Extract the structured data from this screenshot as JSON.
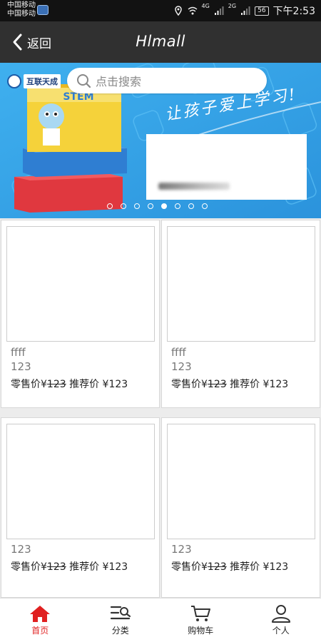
{
  "status_bar": {
    "carrier_line1": "中国移动",
    "carrier_line2": "中国移动",
    "network1": "4G",
    "network2": "2G",
    "battery": "56",
    "time": "下午2:53"
  },
  "header": {
    "back_label": "返回",
    "title": "Hlmall"
  },
  "banner": {
    "logo_text": "互联天成",
    "search_placeholder": "点击搜索",
    "slogan": "让孩子爱上学习!",
    "dot_count": 8,
    "active_dot": 4
  },
  "products": [
    {
      "name": "ffff",
      "num": "123",
      "retail_label": "零售价¥",
      "retail_price": "123",
      "recommend_label": "推荐价 ¥",
      "recommend_price": "123"
    },
    {
      "name": "ffff",
      "num": "123",
      "retail_label": "零售价¥",
      "retail_price": "123",
      "recommend_label": "推荐价 ¥",
      "recommend_price": "123"
    },
    {
      "name": "",
      "num": "123",
      "retail_label": "零售价¥",
      "retail_price": "123",
      "recommend_label": "推荐价 ¥",
      "recommend_price": "123"
    },
    {
      "name": "",
      "num": "123",
      "retail_label": "零售价¥",
      "retail_price": "123",
      "recommend_label": "推荐价 ¥",
      "recommend_price": "123"
    }
  ],
  "tabbar": {
    "items": [
      {
        "label": "首页",
        "icon": "home-icon",
        "active": true
      },
      {
        "label": "分类",
        "icon": "category-icon",
        "active": false
      },
      {
        "label": "购物车",
        "icon": "cart-icon",
        "active": false
      },
      {
        "label": "个人",
        "icon": "user-icon",
        "active": false
      }
    ]
  },
  "colors": {
    "accent": "#e02020",
    "header_bg": "#303030",
    "banner_bg": "#34a4e8"
  }
}
